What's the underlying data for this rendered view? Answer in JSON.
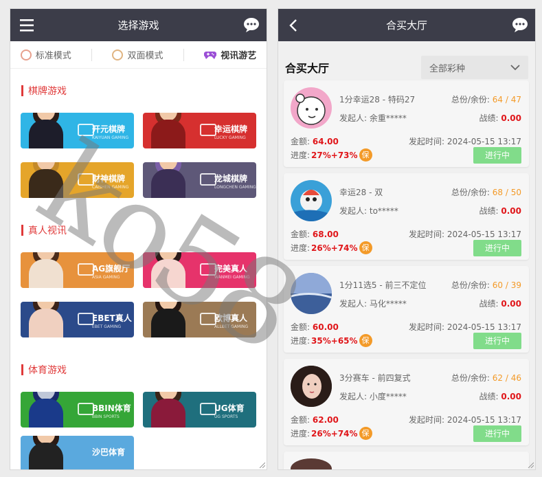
{
  "left_panel": {
    "title": "选择游戏",
    "modes": [
      {
        "label": "标准模式",
        "icon": "standard-mode-icon",
        "active": false
      },
      {
        "label": "双面模式",
        "icon": "double-mode-icon",
        "active": false
      },
      {
        "label": "视讯游艺",
        "icon": "gamepad-icon",
        "active": true
      }
    ],
    "sections": [
      {
        "title": "棋牌游戏",
        "games": [
          {
            "name": "开元棋牌",
            "sub": "KAIYUAN GAMING",
            "color": "#2fb5e6"
          },
          {
            "name": "幸运棋牌",
            "sub": "LUCKY GAMING",
            "color": "#d6302f"
          },
          {
            "name": "财神棋牌",
            "sub": "CAISHEN GAMING",
            "color": "#e5a52a"
          },
          {
            "name": "龙城棋牌",
            "sub": "LONGCHEN GAMING",
            "color": "#5e5878"
          }
        ]
      },
      {
        "title": "真人视讯",
        "games": [
          {
            "name": "AG旗舰厅",
            "sub": "ASIA GAMING",
            "color": "#e7923c"
          },
          {
            "name": "完美真人",
            "sub": "WANMEI GAMING",
            "color": "#e6336b"
          },
          {
            "name": "EBET真人",
            "sub": "EBET GAMING",
            "color": "#2b4a8a"
          },
          {
            "name": "欧博真人",
            "sub": "ALLBET GAMING",
            "color": "#9b7a55"
          }
        ]
      },
      {
        "title": "体育游戏",
        "games": [
          {
            "name": "BBIN体育",
            "sub": "BBIN SPORTS",
            "color": "#35a637"
          },
          {
            "name": "UG体育",
            "sub": "UG SPORTS",
            "color": "#1f6f7d"
          },
          {
            "name": "沙巴体育",
            "sub": "",
            "color": "#5aa9de"
          }
        ]
      }
    ]
  },
  "right_panel": {
    "title": "合买大厅",
    "hall_title": "合买大厅",
    "filter": "全部彩种",
    "offers": [
      {
        "title": "1分幸运28 - 特码27",
        "total_label": "总份/余份:",
        "total": "64 / 47",
        "initiator_label": "发起人:",
        "initiator": "余重*****",
        "record_label": "战绩:",
        "record": "0.00",
        "amount_label": "金额:",
        "amount": "64.00",
        "time_label": "发起时间:",
        "time": "2024-05-15 13:17",
        "progress_label": "进度:",
        "progress": "27%+73%",
        "bao": "保",
        "status": "进行中",
        "avatar_color": "#f2a7c9"
      },
      {
        "title": "幸运28 - 双",
        "total_label": "总份/余份:",
        "total": "68 / 50",
        "initiator_label": "发起人:",
        "initiator": "to*****",
        "record_label": "战绩:",
        "record": "0.00",
        "amount_label": "金额:",
        "amount": "68.00",
        "time_label": "发起时间:",
        "time": "2024-05-15 13:17",
        "progress_label": "进度:",
        "progress": "26%+74%",
        "bao": "保",
        "status": "进行中",
        "avatar_color": "#3aa0d8"
      },
      {
        "title": "1分11选5 - 前三不定位",
        "total_label": "总份/余份:",
        "total": "60 / 39",
        "initiator_label": "发起人:",
        "initiator": "马化*****",
        "record_label": "战绩:",
        "record": "0.00",
        "amount_label": "金额:",
        "amount": "60.00",
        "time_label": "发起时间:",
        "time": "2024-05-15 13:17",
        "progress_label": "进度:",
        "progress": "35%+65%",
        "bao": "保",
        "status": "进行中",
        "avatar_color": "#6b8fc4"
      },
      {
        "title": "3分赛车 - 前四复式",
        "total_label": "总份/余份:",
        "total": "62 / 46",
        "initiator_label": "发起人:",
        "initiator": "小度*****",
        "record_label": "战绩:",
        "record": "0.00",
        "amount_label": "金额:",
        "amount": "62.00",
        "time_label": "发起时间:",
        "time": "2024-05-15 13:17",
        "progress_label": "进度:",
        "progress": "26%+74%",
        "bao": "保",
        "status": "进行中",
        "avatar_color": "#4b3a36"
      }
    ]
  },
  "watermark": "ko58"
}
